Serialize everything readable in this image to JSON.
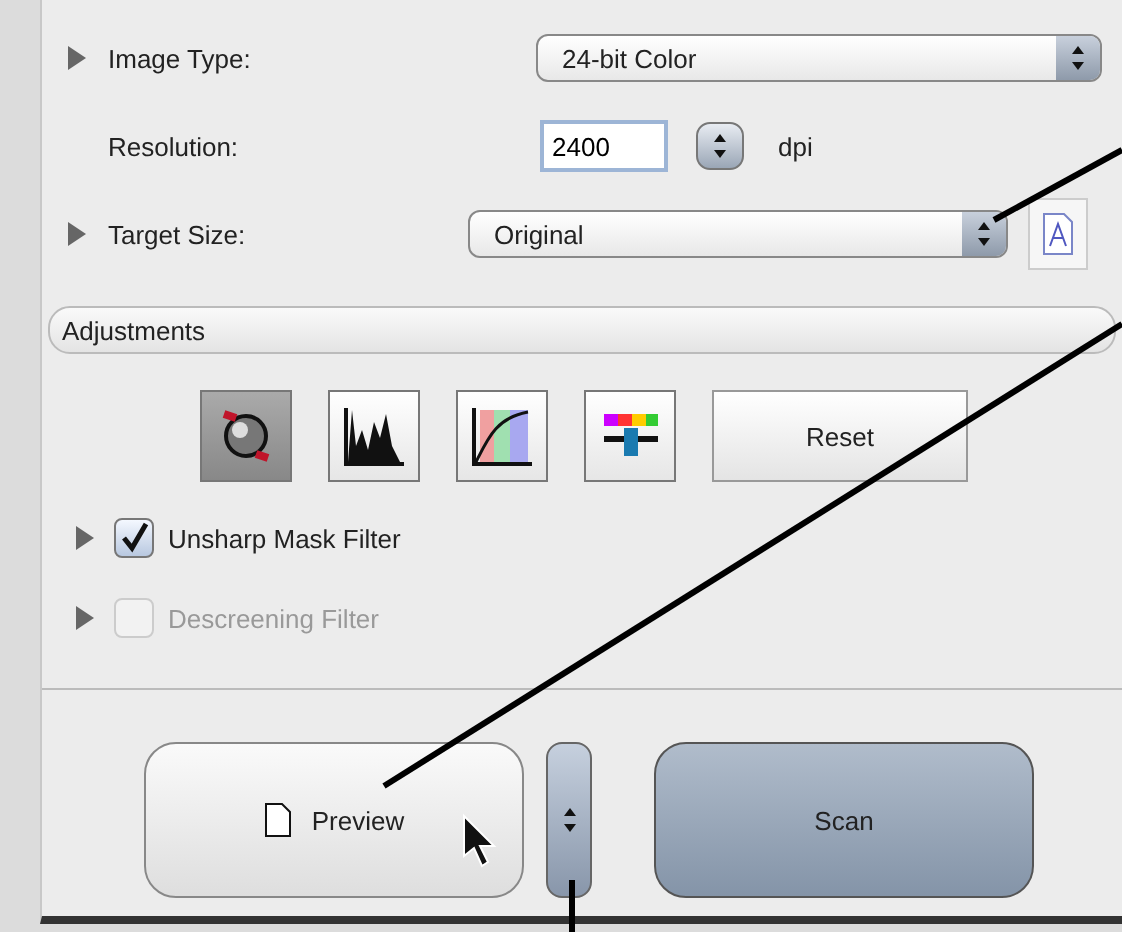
{
  "settings": [
    {
      "kind": "popup",
      "label": "Image Type:",
      "value": "24-bit Color",
      "disclosure": true
    },
    {
      "kind": "number",
      "label": "Resolution:",
      "value": "2400",
      "unit": "dpi",
      "disclosure": false
    },
    {
      "kind": "popup",
      "label": "Target Size:",
      "value": "Original",
      "disclosure": true,
      "doc_button": true
    }
  ],
  "adjustments": {
    "title": "Adjustments",
    "tools": [
      {
        "kind": "color",
        "selected": true
      },
      {
        "kind": "histogram",
        "selected": false
      },
      {
        "kind": "curves",
        "selected": false
      },
      {
        "kind": "balance",
        "selected": false
      }
    ],
    "reset": "Reset",
    "filters": [
      {
        "label": "Unsharp Mask Filter",
        "checked": true,
        "disabled": false
      },
      {
        "label": "Descreening Filter",
        "checked": false,
        "disabled": true
      }
    ]
  },
  "buttons": {
    "preview": "Preview",
    "scan": "Scan"
  }
}
